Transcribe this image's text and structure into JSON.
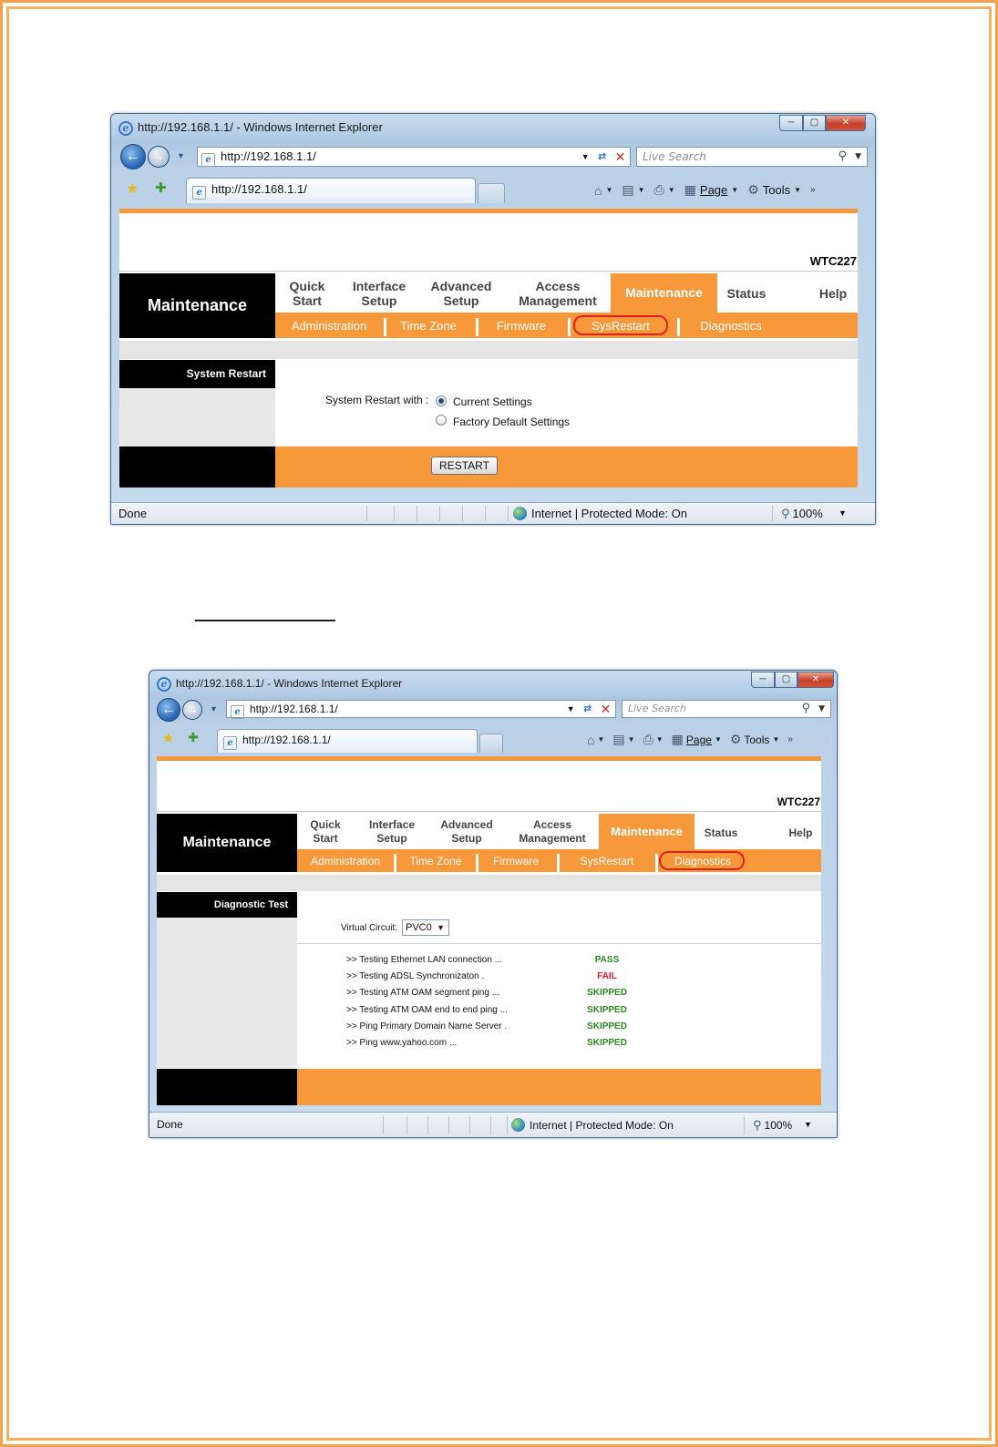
{
  "window_a": {
    "title": "http://192.168.1.1/ - Windows Internet Explorer",
    "url": "http://192.168.1.1/",
    "tab_title": "http://192.168.1.1/",
    "search_placeholder": "Live Search",
    "commands": {
      "page": "Page",
      "tools": "Tools"
    },
    "model": "WTC227",
    "section_title": "Maintenance",
    "menu": [
      {
        "l1": "Quick",
        "l2": "Start"
      },
      {
        "l1": "Interface",
        "l2": "Setup"
      },
      {
        "l1": "Advanced",
        "l2": "Setup"
      },
      {
        "l1": "Access",
        "l2": "Management"
      },
      {
        "l1": "Maintenance",
        "l2": ""
      },
      {
        "l1": "Status",
        "l2": ""
      },
      {
        "l1": "Help",
        "l2": ""
      }
    ],
    "submenu": [
      "Administration",
      "Time Zone",
      "Firmware",
      "SysRestart",
      "Diagnostics"
    ],
    "panel_label": "System Restart",
    "restart_with_label": "System Restart with :",
    "option_current": "Current Settings",
    "option_factory": "Factory Default Settings",
    "restart_button": "RESTART",
    "status": {
      "done": "Done",
      "zone": "Internet | Protected Mode: On",
      "zoom": "100%"
    }
  },
  "window_b": {
    "title": "http://192.168.1.1/ - Windows Internet Explorer",
    "url": "http://192.168.1.1/",
    "tab_title": "http://192.168.1.1/",
    "search_placeholder": "Live Search",
    "commands": {
      "page": "Page",
      "tools": "Tools"
    },
    "model": "WTC227",
    "section_title": "Maintenance",
    "menu": [
      {
        "l1": "Quick",
        "l2": "Start"
      },
      {
        "l1": "Interface",
        "l2": "Setup"
      },
      {
        "l1": "Advanced",
        "l2": "Setup"
      },
      {
        "l1": "Access",
        "l2": "Management"
      },
      {
        "l1": "Maintenance",
        "l2": ""
      },
      {
        "l1": "Status",
        "l2": ""
      },
      {
        "l1": "Help",
        "l2": ""
      }
    ],
    "submenu": [
      "Administration",
      "Time Zone",
      "Firmware",
      "SysRestart",
      "Diagnostics"
    ],
    "panel_label": "Diagnostic Test",
    "vc_label": "Virtual Circuit:",
    "vc_value": "PVC0",
    "tests": [
      {
        "name": ">> Testing Ethernet LAN connection ...",
        "result": "PASS"
      },
      {
        "name": ">> Testing ADSL Synchronizaton .",
        "result": "FAIL"
      },
      {
        "name": ">> Testing ATM OAM segment ping ...",
        "result": "SKIPPED"
      },
      {
        "name": ">> Testing ATM OAM end to end ping ...",
        "result": "SKIPPED"
      },
      {
        "name": ">> Ping Primary Domain Name Server .",
        "result": "SKIPPED"
      },
      {
        "name": ">> Ping www.yahoo.com ...",
        "result": "SKIPPED"
      }
    ],
    "status": {
      "done": "Done",
      "zone": "Internet | Protected Mode: On",
      "zoom": "100%"
    }
  },
  "colors": {
    "orange": "#f7993a",
    "pass": "#2a8a1e",
    "fail": "#d81e1e",
    "skipped": "#2a8a1e",
    "highlight": "#e0211b"
  }
}
